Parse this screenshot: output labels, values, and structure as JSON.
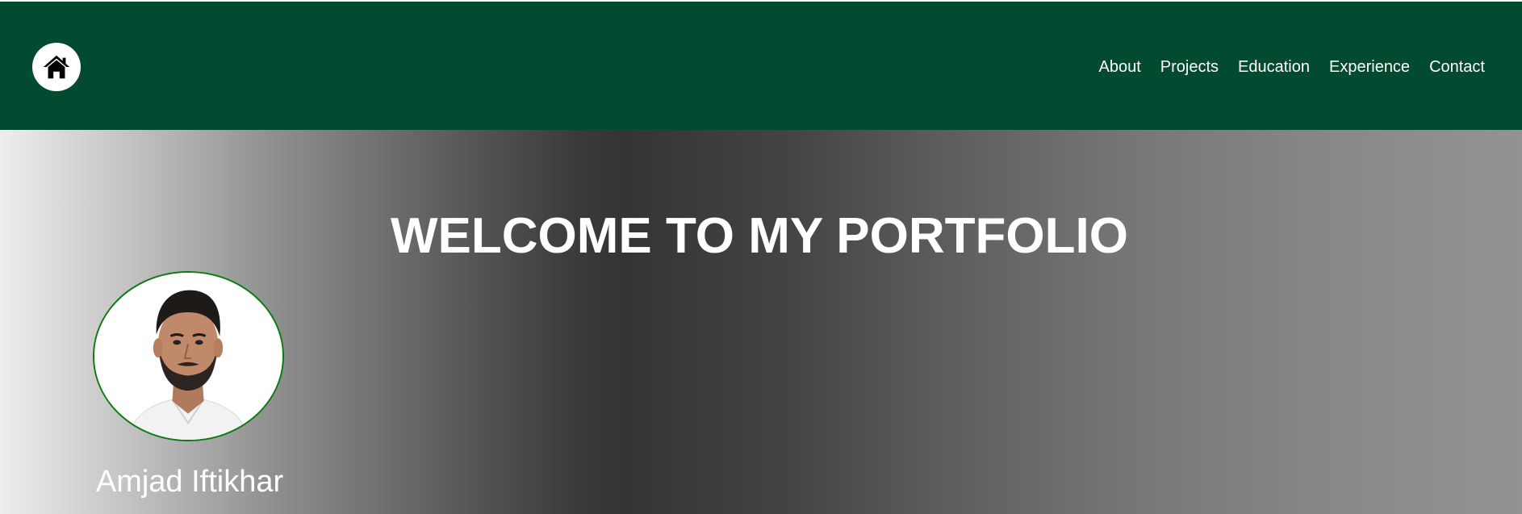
{
  "nav": {
    "home_icon": "home-icon",
    "links": [
      {
        "label": "About"
      },
      {
        "label": "Projects"
      },
      {
        "label": "Education"
      },
      {
        "label": "Experience"
      },
      {
        "label": "Contact"
      }
    ]
  },
  "hero": {
    "title": "WELCOME TO MY PORTFOLIO",
    "profile_name": "Amjad Iftikhar"
  },
  "colors": {
    "navbar_bg": "#024a30",
    "photo_border": "#0d7a14",
    "text": "#ffffff"
  }
}
